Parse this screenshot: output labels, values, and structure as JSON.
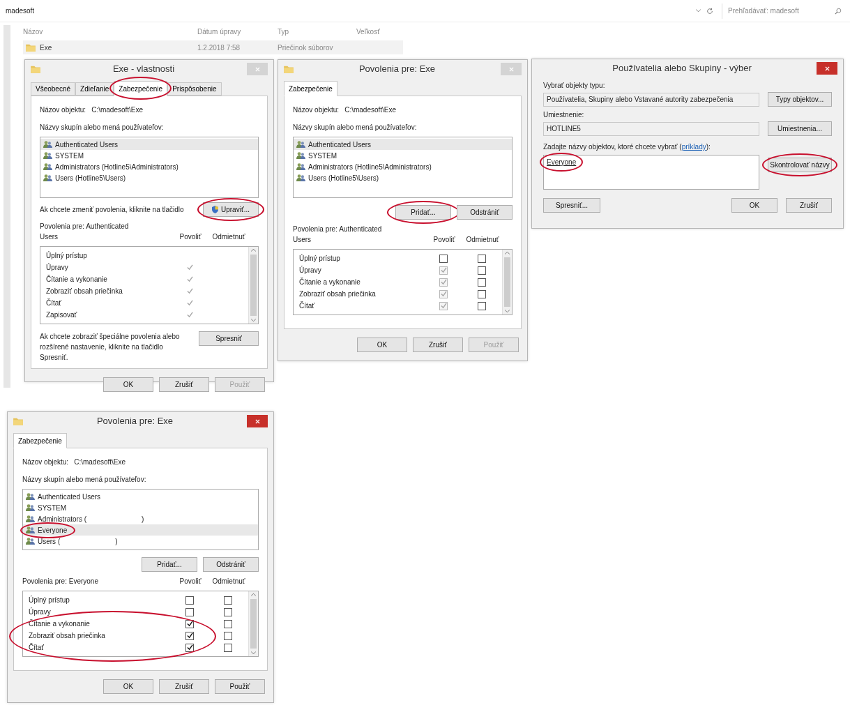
{
  "explorer": {
    "path": "madesoft",
    "search": {
      "placeholder": "Prehľadávať: madesoft"
    },
    "columns": [
      "Názov",
      "Dátum úpravy",
      "Typ",
      "Veľkosť"
    ],
    "rows": [
      {
        "name": "Exe",
        "date": "1.2.2018 7:58",
        "type": "Priečinok súborov",
        "selected": true
      }
    ]
  },
  "dialogs": [
    {
      "kind": "permissions",
      "title": "Exe - vlastnosti",
      "active": false,
      "tabs": [
        {
          "label": "Všeobecné",
          "selected": false,
          "circled": false
        },
        {
          "label": "Zdieľanie",
          "selected": false,
          "circled": false
        },
        {
          "label": "Zabezpečenie",
          "selected": true,
          "circled": true
        },
        {
          "label": "Prispôsobenie",
          "selected": false,
          "circled": false
        }
      ],
      "object_label": "Názov objektu:",
      "object_value": "C:\\madesoft\\Exe",
      "groups_label": "Názvy skupín alebo mená používateľov:",
      "groups": [
        {
          "name": "Authenticated Users",
          "selected": true,
          "circled": false
        },
        {
          "name": "SYSTEM",
          "selected": false,
          "circled": false
        },
        {
          "name": "Administrators (Hotline5\\Administrators)",
          "selected": false,
          "circled": false
        },
        {
          "name": "Users (Hotline5\\Users)",
          "selected": false,
          "circled": false
        }
      ],
      "edit_note": "Ak chcete zmeniť povolenia, kliknite na tlačidlo",
      "edit_button": {
        "label": "Upraviť...",
        "circled": true
      },
      "perm_label": "Povolenia pre: Authenticated Users",
      "allow_label": "Povoliť",
      "deny_label": "Odmietnuť",
      "permissions": [
        {
          "kind": "tick",
          "name": "Úplný prístup",
          "allow": false
        },
        {
          "kind": "tick",
          "name": "Úpravy",
          "allow": true
        },
        {
          "kind": "tick",
          "name": "Čítanie a vykonanie",
          "allow": true
        },
        {
          "kind": "tick",
          "name": "Zobraziť obsah priečinka",
          "allow": true
        },
        {
          "kind": "tick",
          "name": "Čítať",
          "allow": true
        },
        {
          "kind": "tick",
          "name": "Zapisovať",
          "allow": true
        }
      ],
      "advanced_note": "Ak chcete zobraziť špeciálne povolenia alebo rozšírené nastavenie, kliknite na tlačidlo Spresniť.",
      "advanced_button": "Spresniť",
      "buttons": [
        {
          "label": "OK",
          "disabled": false
        },
        {
          "label": "Zrušiť",
          "disabled": false
        },
        {
          "label": "Použiť",
          "disabled": true
        }
      ]
    },
    {
      "kind": "permissions",
      "title": "Povolenia pre: Exe",
      "active": false,
      "tabs": [
        {
          "label": "Zabezpečenie",
          "selected": true,
          "circled": false
        }
      ],
      "object_label": "Názov objektu:",
      "object_value": "C:\\madesoft\\Exe",
      "groups_label": "Názvy skupín alebo mená používateľov:",
      "groups": [
        {
          "name": "Authenticated Users",
          "selected": true,
          "circled": false
        },
        {
          "name": "SYSTEM",
          "selected": false,
          "circled": false
        },
        {
          "name": "Administrators (Hotline5\\Administrators)",
          "selected": false,
          "circled": false
        },
        {
          "name": "Users (Hotline5\\Users)",
          "selected": false,
          "circled": false
        }
      ],
      "group_buttons": [
        {
          "label": "Pridať...",
          "circled": true
        },
        {
          "label": "Odstrániť",
          "circled": false
        }
      ],
      "perm_label": "Povolenia pre: Authenticated Users",
      "allow_label": "Povoliť",
      "deny_label": "Odmietnuť",
      "permissions": [
        {
          "kind": "checkbox",
          "name": "Úplný prístup",
          "allow": false,
          "deny": false
        },
        {
          "kind": "checkbox",
          "name": "Úpravy",
          "allow": true,
          "deny": false,
          "inherited": true
        },
        {
          "kind": "checkbox",
          "name": "Čítanie a vykonanie",
          "allow": true,
          "deny": false,
          "inherited": true
        },
        {
          "kind": "checkbox",
          "name": "Zobraziť obsah priečinka",
          "allow": true,
          "deny": false,
          "inherited": true
        },
        {
          "kind": "checkbox",
          "name": "Čítať",
          "allow": true,
          "deny": false,
          "inherited": true
        }
      ],
      "buttons": [
        {
          "label": "OK",
          "disabled": false
        },
        {
          "label": "Zrušiť",
          "disabled": false
        },
        {
          "label": "Použiť",
          "disabled": true
        }
      ]
    },
    {
      "kind": "select_users",
      "title": "Používatelia alebo Skupiny - výber",
      "active": true,
      "fields": [
        {
          "label": "Vybrať objekty typu:",
          "value": "Používatelia, Skupiny alebo Vstavané autority zabezpečenia",
          "button": "Typy objektov..."
        },
        {
          "label": "Umiestnenie:",
          "value": "HOTLINE5",
          "button": "Umiestnenia..."
        }
      ],
      "names_label": "Zadajte názvy objektov, ktoré chcete vybrať (",
      "names_link": "príklady",
      "names_label_end": "):",
      "names_value": "Everyone",
      "names_circled": true,
      "check_button": {
        "label": "Skontrolovať názvy",
        "circled": true
      },
      "advanced_button": "Spresniť...",
      "buttons": [
        {
          "label": "OK",
          "disabled": false
        },
        {
          "label": "Zrušiť",
          "disabled": false
        }
      ]
    },
    {
      "kind": "permissions",
      "title": "Povolenia pre: Exe",
      "active": true,
      "tabs": [
        {
          "label": "Zabezpečenie",
          "selected": true,
          "circled": false
        }
      ],
      "object_label": "Názov objektu:",
      "object_value": "C:\\madesoft\\Exe",
      "groups_label": "Názvy skupín alebo mená používateľov:",
      "groups": [
        {
          "name": "Authenticated Users",
          "selected": false,
          "circled": false
        },
        {
          "name": "SYSTEM",
          "selected": false,
          "circled": false
        },
        {
          "name": "Administrators (",
          "suffix": ")",
          "selected": false,
          "circled": false
        },
        {
          "name": "Everyone",
          "selected": true,
          "circled": true
        },
        {
          "name": "Users (",
          "suffix": ")",
          "selected": false,
          "circled": false
        }
      ],
      "group_buttons": [
        {
          "label": "Pridať...",
          "circled": false
        },
        {
          "label": "Odstrániť",
          "circled": false
        }
      ],
      "perm_label": "Povolenia pre: Everyone",
      "allow_label": "Povoliť",
      "deny_label": "Odmietnuť",
      "permissions": [
        {
          "kind": "checkbox",
          "name": "Úplný prístup",
          "allow": false,
          "deny": false,
          "circled": false
        },
        {
          "kind": "checkbox",
          "name": "Úpravy",
          "allow": false,
          "deny": false,
          "circled": false
        },
        {
          "kind": "checkbox",
          "name": "Čítanie a vykonanie",
          "allow": true,
          "deny": false,
          "circled": true
        },
        {
          "kind": "checkbox",
          "name": "Zobraziť obsah priečinka",
          "allow": true,
          "deny": false,
          "circled": true
        },
        {
          "kind": "checkbox",
          "name": "Čítať",
          "allow": true,
          "deny": false,
          "circled": true
        }
      ],
      "buttons": [
        {
          "label": "OK",
          "disabled": false
        },
        {
          "label": "Zrušiť",
          "disabled": false
        },
        {
          "label": "Použiť",
          "disabled": false
        }
      ]
    }
  ]
}
